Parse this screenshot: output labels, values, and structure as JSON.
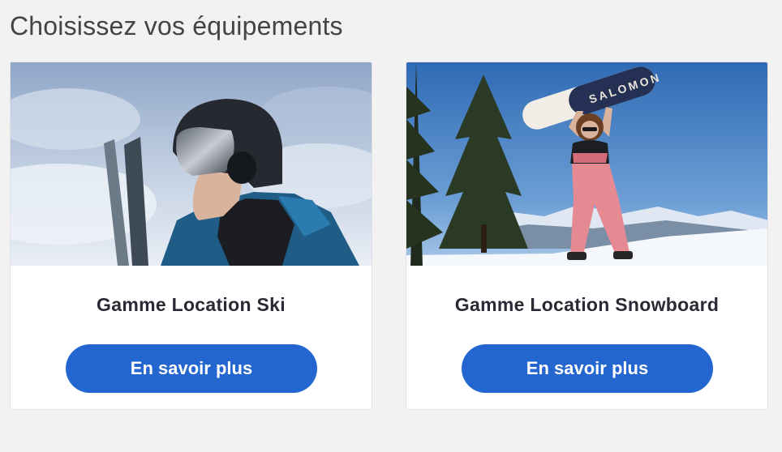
{
  "section": {
    "title": "Choisissez vos équipements"
  },
  "cards": [
    {
      "title": "Gamme Location Ski",
      "button_label": "En savoir plus"
    },
    {
      "title": "Gamme Location Snowboard",
      "button_label": "En savoir plus",
      "board_brand": "SALOMON"
    }
  ],
  "colors": {
    "accent": "#2466cf",
    "background": "#f2f2f2",
    "card": "#ffffff",
    "title_text": "#2a2a35"
  }
}
